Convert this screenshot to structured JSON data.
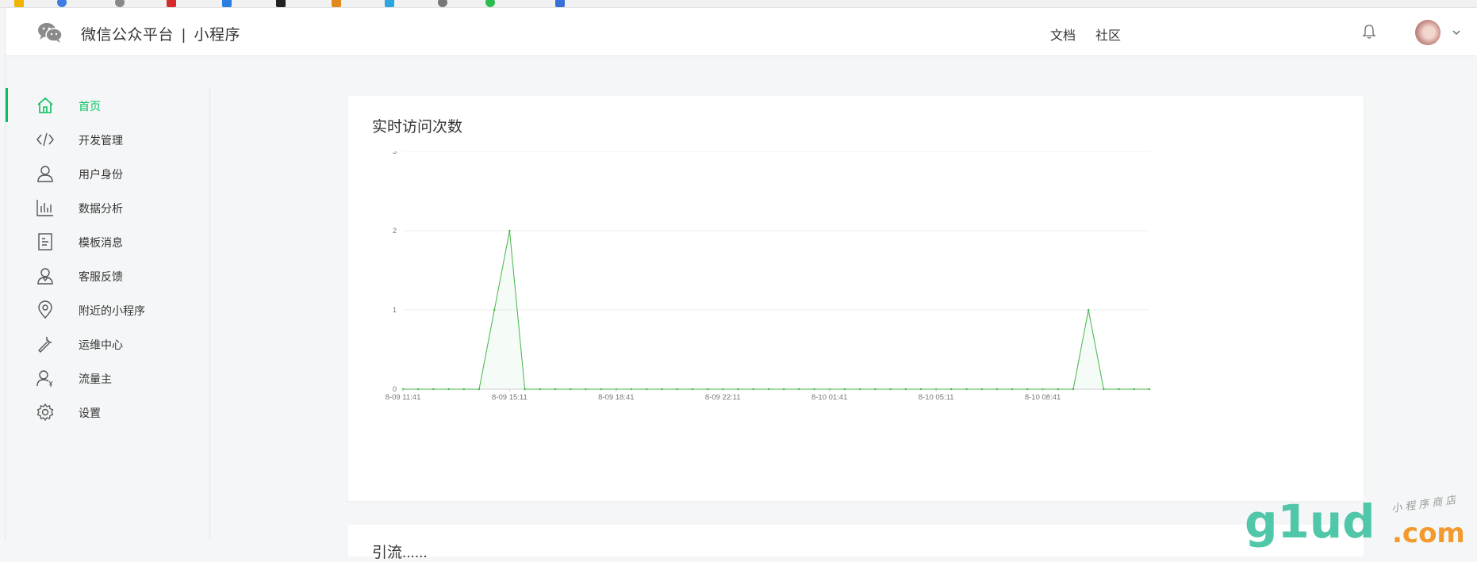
{
  "header": {
    "brand": "微信公众平台",
    "separator": "|",
    "product": "小程序",
    "links": [
      "文档",
      "社区"
    ]
  },
  "sidebar": {
    "items": [
      {
        "label": "首页",
        "icon": "home-icon",
        "active": true
      },
      {
        "label": "开发管理",
        "icon": "code-icon"
      },
      {
        "label": "用户身份",
        "icon": "user-icon"
      },
      {
        "label": "数据分析",
        "icon": "bar-chart-icon"
      },
      {
        "label": "模板消息",
        "icon": "document-icon"
      },
      {
        "label": "客服反馈",
        "icon": "customer-service-icon"
      },
      {
        "label": "附近的小程序",
        "icon": "location-pin-icon"
      },
      {
        "label": "运维中心",
        "icon": "wrench-icon"
      },
      {
        "label": "流量主",
        "icon": "user-yen-icon"
      },
      {
        "label": "设置",
        "icon": "gear-icon"
      }
    ]
  },
  "main": {
    "card_title": "实时访问次数",
    "next_card_title": "引流......"
  },
  "watermark": {
    "logo": "g1ud",
    "suffix": ".com",
    "tagline": "小 程 序 商 店"
  },
  "colors": {
    "accent": "#07c160",
    "line": "#44b549"
  },
  "chart_data": {
    "type": "area",
    "title": "实时访问次数",
    "ylim": [
      0,
      3
    ],
    "yticks": [
      0,
      1,
      2,
      3
    ],
    "xticks": [
      "8-09 11:41",
      "8-09 15:11",
      "8-09 18:41",
      "8-09 22:11",
      "8-10 01:41",
      "8-10 05:11",
      "8-10 08:41"
    ],
    "x": [
      "8-09 11:41",
      "8-09 12:11",
      "8-09 12:41",
      "8-09 13:11",
      "8-09 13:41",
      "8-09 14:11",
      "8-09 14:41",
      "8-09 15:11",
      "8-09 15:41",
      "8-09 16:11",
      "8-09 16:41",
      "8-09 17:11",
      "8-09 17:41",
      "8-09 18:11",
      "8-09 18:41",
      "8-09 19:11",
      "8-09 19:41",
      "8-09 20:11",
      "8-09 20:41",
      "8-09 21:11",
      "8-09 21:41",
      "8-09 22:11",
      "8-09 22:41",
      "8-09 23:11",
      "8-09 23:41",
      "8-10 00:11",
      "8-10 00:41",
      "8-10 01:11",
      "8-10 01:41",
      "8-10 02:11",
      "8-10 02:41",
      "8-10 03:11",
      "8-10 03:41",
      "8-10 04:11",
      "8-10 04:41",
      "8-10 05:11",
      "8-10 05:41",
      "8-10 06:11",
      "8-10 06:41",
      "8-10 07:11",
      "8-10 07:41",
      "8-10 08:11",
      "8-10 08:41",
      "8-10 09:11",
      "8-10 09:41",
      "8-10 10:11",
      "8-10 10:41",
      "8-10 11:11",
      "8-10 11:41",
      "8-10 12:11"
    ],
    "values": [
      0,
      0,
      0,
      0,
      0,
      0,
      1,
      2,
      0,
      0,
      0,
      0,
      0,
      0,
      0,
      0,
      0,
      0,
      0,
      0,
      0,
      0,
      0,
      0,
      0,
      0,
      0,
      0,
      0,
      0,
      0,
      0,
      0,
      0,
      0,
      0,
      0,
      0,
      0,
      0,
      0,
      0,
      0,
      0,
      0,
      1,
      0,
      0,
      0,
      0
    ],
    "grid": true,
    "legend": "none"
  }
}
